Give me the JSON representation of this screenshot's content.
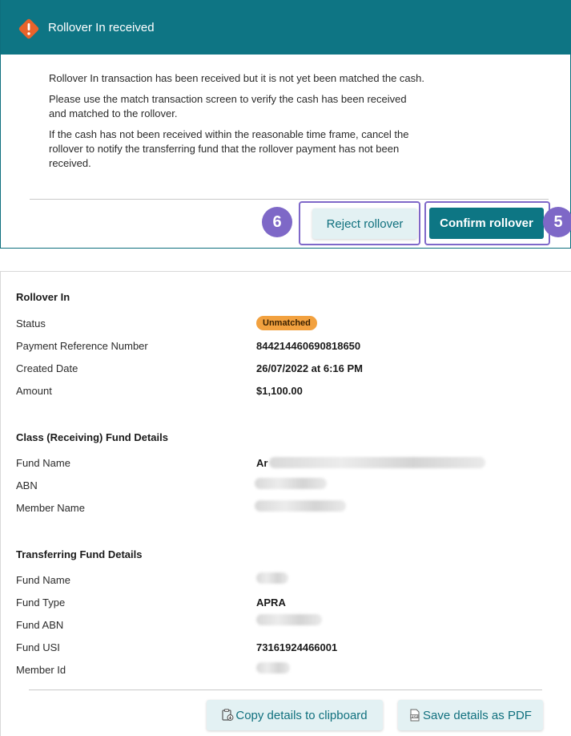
{
  "alert": {
    "title": "Rollover In received",
    "messages": [
      "Rollover In transaction has been received but it is not yet been matched the cash.",
      "Please use the match transaction screen to verify the cash has been received and matched to the rollover.",
      "If the cash has not been received within the reasonable time frame, cancel the rollover to notify the transferring fund that the rollover payment has not been received."
    ],
    "reject_label": "Reject rollover",
    "confirm_label": "Confirm rollover",
    "reject_step": "6",
    "confirm_step": "5"
  },
  "rollover_in": {
    "title": "Rollover In",
    "status_label": "Status",
    "status_value": "Unmatched",
    "payment_ref_label": "Payment Reference Number",
    "payment_ref_value": "844214460690818650",
    "created_label": "Created Date",
    "created_value": "26/07/2022 at 6:16 PM",
    "amount_label": "Amount",
    "amount_value": "$1,100.00"
  },
  "receiving_fund": {
    "title": "Class (Receiving) Fund Details",
    "fund_name_label": "Fund Name",
    "fund_name_visible": "Ar",
    "abn_label": "ABN",
    "member_name_label": "Member Name"
  },
  "transferring_fund": {
    "title": "Transferring Fund Details",
    "fund_name_label": "Fund Name",
    "fund_type_label": "Fund Type",
    "fund_type_value": "APRA",
    "fund_abn_label": "Fund ABN",
    "fund_usi_label": "Fund USI",
    "fund_usi_value": "73161924466001",
    "member_id_label": "Member Id"
  },
  "actions": {
    "copy_label": "Copy details to clipboard",
    "pdf_label": "Save details as PDF"
  },
  "colors": {
    "header": "#0e7584",
    "primary_button": "#0d7684",
    "secondary_button": "#e3f1f3",
    "highlight": "#7e68c7",
    "warning_icon": "#e8632b",
    "status_badge": "#f2a13f"
  },
  "icons": {
    "alert": "warning-diamond-icon",
    "copy": "clipboard-icon",
    "pdf": "pdf-icon"
  }
}
